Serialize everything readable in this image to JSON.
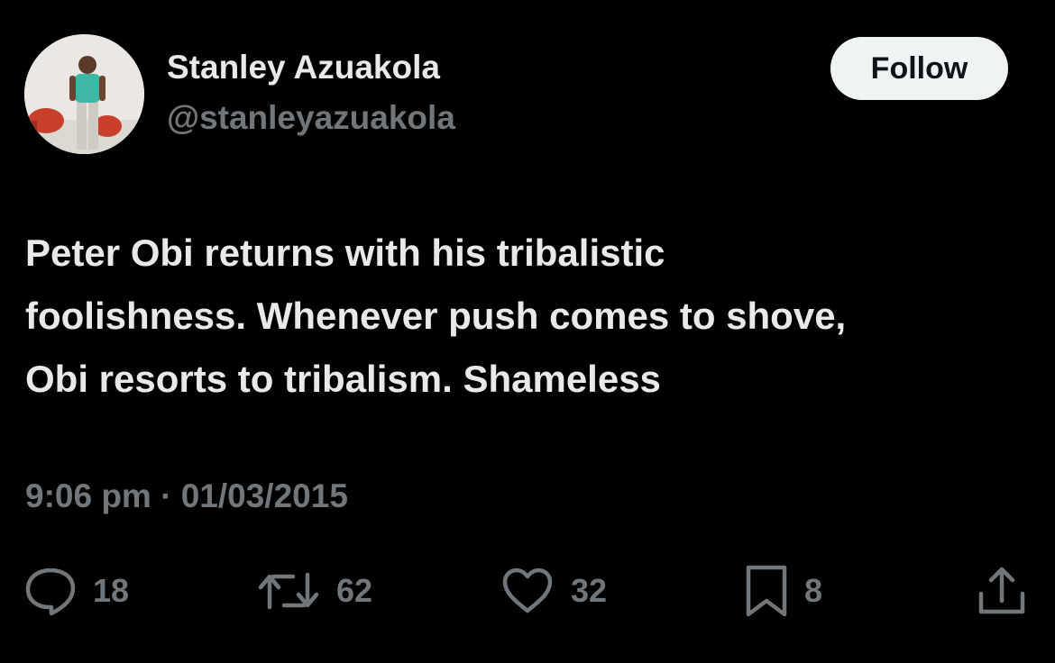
{
  "author": {
    "name": "Stanley Azuakola",
    "handle": "@stanleyazuakola"
  },
  "follow_button": {
    "label": "Follow"
  },
  "tweet": {
    "lines": [
      "Peter Obi returns with his tribalistic",
      "foolishness. Whenever push comes to shove,",
      "Obi resorts to tribalism. Shameless"
    ],
    "timestamp": "9:06 pm · 01/03/2015"
  },
  "actions": {
    "replies": "18",
    "retweets": "62",
    "likes": "32",
    "bookmarks": "8"
  },
  "icons": {
    "reply": "speech-bubble-icon",
    "retweet": "retweet-arrows-icon",
    "like": "heart-icon",
    "bookmark": "bookmark-icon",
    "share": "share-upload-icon"
  },
  "colors": {
    "background": "#000000",
    "primary_text": "#e7e9ea",
    "secondary_text": "#71767b",
    "follow_bg": "#eff3f4",
    "follow_text": "#0f1419"
  }
}
